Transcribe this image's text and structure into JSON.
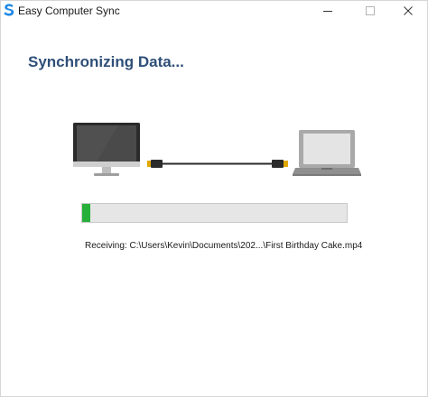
{
  "window": {
    "title": "Easy Computer Sync"
  },
  "heading": "Synchronizing Data...",
  "progress": {
    "fraction": 0.03,
    "fill_color": "#26b03a"
  },
  "status": {
    "text": "Receiving: C:\\Users\\Kevin\\Documents\\202...\\First Birthday Cake.mp4"
  },
  "colors": {
    "accent": "#2f4f78",
    "logo": "#1e88e5"
  },
  "icons": {
    "source_device": "desktop-monitor-icon",
    "target_device": "laptop-icon",
    "connector": "usb-cable-icon"
  }
}
